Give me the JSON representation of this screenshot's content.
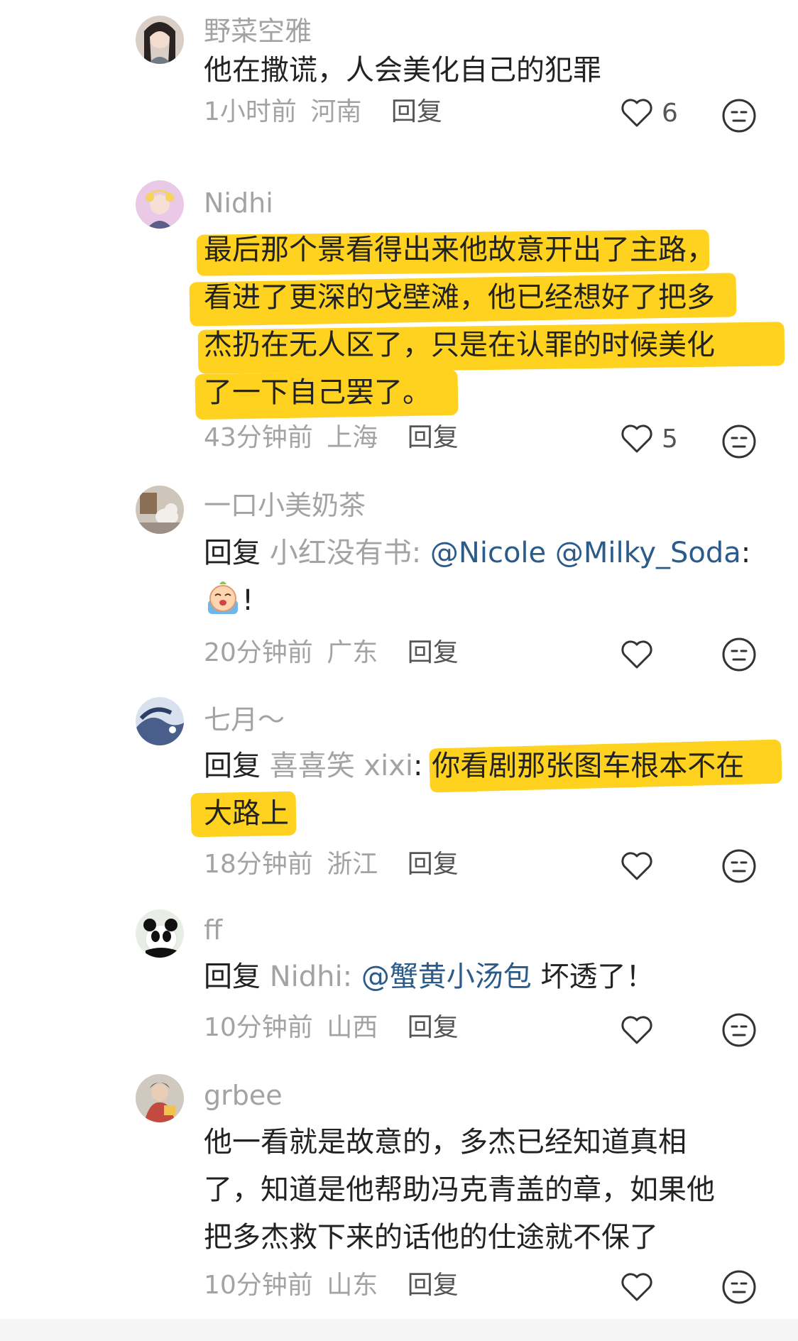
{
  "comments": [
    {
      "username": "野菜空雅",
      "lines": [
        "他在撒谎，人会美化自己的犯罪"
      ],
      "time": "1小时前",
      "location": "河南",
      "reply_label": "回复",
      "likes": "6"
    },
    {
      "username": "Nidhi",
      "lines": [
        "最后那个景看得出来他故意开出了主路，",
        "看进了更深的戈壁滩，他已经想好了把多",
        "杰扔在无人区了，只是在认罪的时候美化",
        "了一下自己罢了。"
      ],
      "time": "43分钟前",
      "location": "上海",
      "reply_label": "回复",
      "likes": "5"
    },
    {
      "username": "一口小美奶茶",
      "reply_prefix": "回复",
      "reply_target": "小红没有书",
      "colon": ":",
      "mentions": [
        "@Nicole",
        "@Milky_Soda"
      ],
      "emoji_suffix": "!",
      "time": "20分钟前",
      "location": "广东",
      "reply_label": "回复"
    },
    {
      "username": "七月～",
      "reply_prefix": "回复",
      "reply_target": "喜喜笑 xixi",
      "colon": ":",
      "lines": [
        "你看剧那张图车根本不在",
        "大路上"
      ],
      "time": "18分钟前",
      "location": "浙江",
      "reply_label": "回复"
    },
    {
      "username": "ff",
      "reply_prefix": "回复",
      "reply_target": "Nidhi",
      "colon": ":",
      "mentions": [
        "@蟹黄小汤包"
      ],
      "text": "坏透了！",
      "time": "10分钟前",
      "location": "山西",
      "reply_label": "回复"
    },
    {
      "username": "grbee",
      "lines": [
        "他一看就是故意的，多杰已经知道真相",
        "了，知道是他帮助冯克青盖的章，如果他",
        "把多杰救下来的话他的仕途就不保了"
      ],
      "time": "10分钟前",
      "location": "山东",
      "reply_label": "回复"
    }
  ],
  "colors": {
    "highlight": "#ffd21f",
    "meta_gray": "#a3a3a3",
    "mention_blue": "#2a5b8a",
    "text": "#222222"
  }
}
